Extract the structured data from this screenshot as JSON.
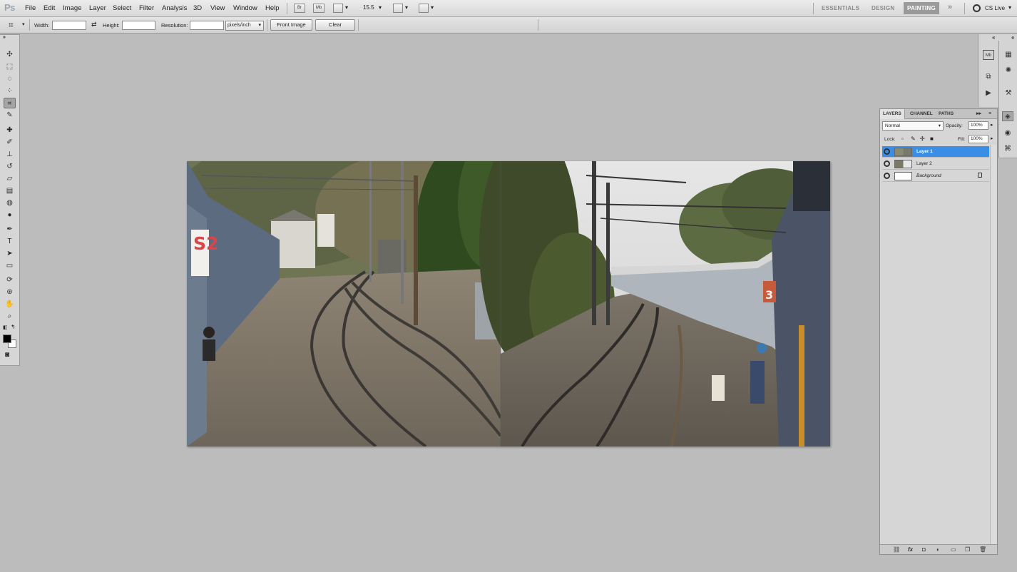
{
  "app": {
    "logo": "Ps"
  },
  "menu": {
    "items": [
      "File",
      "Edit",
      "Image",
      "Layer",
      "Select",
      "Filter",
      "Analysis",
      "3D",
      "View",
      "Window",
      "Help"
    ],
    "bridge_btn": "Br",
    "minibridge_btn": "Mb",
    "zoom": "15.5",
    "workspaces": [
      "ESSENTIALS",
      "DESIGN",
      "PAINTING"
    ],
    "active_workspace": "PAINTING",
    "more": "»",
    "cslive": "CS Live"
  },
  "options": {
    "width_label": "Width:",
    "height_label": "Height:",
    "resolution_label": "Resolution:",
    "resolution_unit": "pixels/inch",
    "front_image_btn": "Front Image",
    "clear_btn": "Clear",
    "swap_icon": "⇄"
  },
  "tools": [
    {
      "name": "move-tool",
      "glyph": "✣"
    },
    {
      "name": "marquee-tool",
      "glyph": "⬚"
    },
    {
      "name": "lasso-tool",
      "glyph": "◌"
    },
    {
      "name": "quick-select-tool",
      "glyph": "⁘"
    },
    {
      "name": "crop-tool",
      "glyph": "⌗"
    },
    {
      "name": "eyedropper-tool",
      "glyph": "✎"
    },
    {
      "name": "healing-brush-tool",
      "glyph": "✚"
    },
    {
      "name": "brush-tool",
      "glyph": "✐"
    },
    {
      "name": "clone-stamp-tool",
      "glyph": "⊥"
    },
    {
      "name": "history-brush-tool",
      "glyph": "↺"
    },
    {
      "name": "eraser-tool",
      "glyph": "▱"
    },
    {
      "name": "gradient-tool",
      "glyph": "▤"
    },
    {
      "name": "blur-tool",
      "glyph": "◍"
    },
    {
      "name": "dodge-tool",
      "glyph": "●"
    },
    {
      "name": "pen-tool",
      "glyph": "✒"
    },
    {
      "name": "type-tool",
      "glyph": "T"
    },
    {
      "name": "path-select-tool",
      "glyph": "➤"
    },
    {
      "name": "shape-tool",
      "glyph": "▭"
    },
    {
      "name": "3d-rotate-tool",
      "glyph": "⟳"
    },
    {
      "name": "3d-orbit-tool",
      "glyph": "⊛"
    },
    {
      "name": "hand-tool",
      "glyph": "✋"
    },
    {
      "name": "zoom-tool",
      "glyph": "⌕"
    }
  ],
  "active_tool": "crop-tool",
  "layers_panel": {
    "tabs": [
      "LAYERS",
      "CHANNEL",
      "PATHS"
    ],
    "blend_mode": "Normal",
    "opacity_label": "Opacity:",
    "opacity_value": "100%",
    "lock_label": "Lock:",
    "fill_label": "Fill:",
    "fill_value": "100%",
    "layers": [
      {
        "name": "Layer 1",
        "selected": true
      },
      {
        "name": "Layer 2",
        "selected": false
      },
      {
        "name": "Background",
        "selected": false,
        "locked": true
      }
    ],
    "footer_icons": [
      "link-icon",
      "fx-icon",
      "mask-icon",
      "adjustment-icon",
      "group-icon",
      "new-layer-icon",
      "trash-icon"
    ]
  },
  "canvas": {
    "left_photo_sign": "S2",
    "right_photo_sign": "3"
  }
}
